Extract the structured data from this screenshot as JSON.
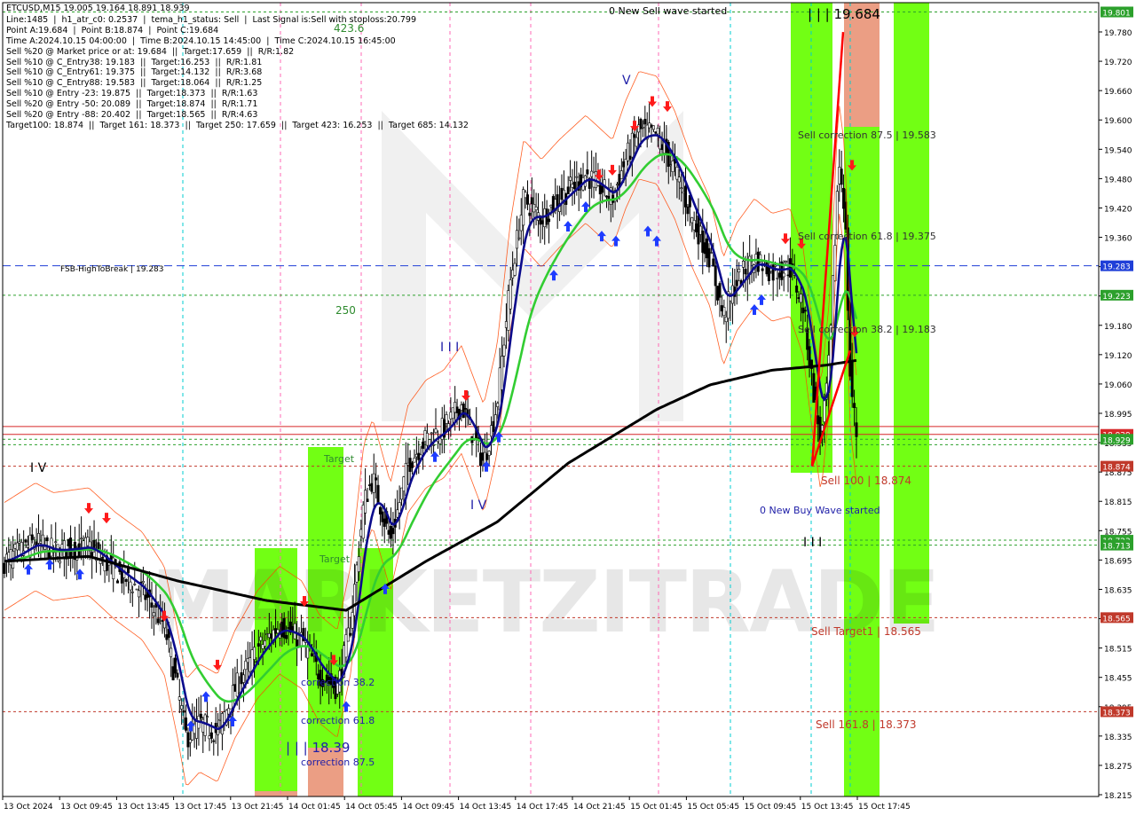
{
  "chart_data": {
    "type": "candlestick",
    "symbol_header": "ETCUSD,M15  19.005 19.164 18.891 18.939",
    "info_lines": [
      "Line:1485  |  h1_atr_c0: 0.2537  |  tema_h1_status: Sell  |  Last Signal is:Sell with stoploss:20.799",
      "Point A:19.684  |  Point B:18.874  |  Point C:19.684",
      "Time A:2024.10.15 04:00:00  |  Time B:2024.10.15 14:45:00  |  Time C:2024.10.15 16:45:00",
      "Sell %20 @ Market price or at: 19.684  ||  Target:17.659  ||  R/R:1.82",
      "Sell %10 @ C_Entry38: 19.183  ||  Target:16.253  ||  R/R:1.81",
      "Sell %10 @ C_Entry61: 19.375  ||  Target:14.132  ||  R/R:3.68",
      "Sell %10 @ C_Entry88: 19.583  ||  Target:18.064  ||  R/R:1.25",
      "Sell %10 @ Entry -23: 19.875  ||  Target:18.373  ||  R/R:1.63",
      "Sell %20 @ Entry -50: 20.089  ||  Target:18.874  ||  R/R:1.71",
      "Sell %20 @ Entry -88: 20.402  ||  Target:18.565  ||  R/R:4.63",
      "Target100: 18.874  ||  Target 161: 18.373  ||  Target 250: 17.659  ||  Target 423: 16.253  ||  Target 685: 14.132"
    ],
    "y_ticks": [
      "19.780",
      "19.720",
      "19.660",
      "19.600",
      "19.540",
      "19.480",
      "19.420",
      "19.360",
      "19.300",
      "19.240",
      "19.180",
      "19.120",
      "19.060",
      "18.995",
      "18.935",
      "18.875",
      "18.815",
      "18.755",
      "18.695",
      "18.635",
      "18.575",
      "18.515",
      "18.455",
      "18.395",
      "18.335",
      "18.275",
      "18.215"
    ],
    "x_ticks": [
      "13 Oct 2024",
      "13 Oct 09:45",
      "13 Oct 13:45",
      "13 Oct 17:45",
      "13 Oct 21:45",
      "14 Oct 01:45",
      "14 Oct 05:45",
      "14 Oct 09:45",
      "14 Oct 13:45",
      "14 Oct 17:45",
      "14 Oct 21:45",
      "15 Oct 01:45",
      "15 Oct 05:45",
      "15 Oct 09:45",
      "15 Oct 13:45",
      "15 Oct 17:45"
    ],
    "ylim": [
      18.2,
      19.82
    ],
    "price_badges": [
      {
        "label": "19.801",
        "value": 19.801,
        "color": "#2ca02c"
      },
      {
        "label": "19.283",
        "value": 19.283,
        "color": "#1f3fd8"
      },
      {
        "label": "19.223",
        "value": 19.223,
        "color": "#2ca02c"
      },
      {
        "label": "18.939",
        "value": 18.939,
        "color": "#d62728"
      },
      {
        "label": "18.929",
        "value": 18.929,
        "color": "#2ca02c"
      },
      {
        "label": "18.874",
        "value": 18.874,
        "color": "#c0392b"
      },
      {
        "label": "18.723",
        "value": 18.723,
        "color": "#2ca02c"
      },
      {
        "label": "18.713",
        "value": 18.713,
        "color": "#2ca02c"
      },
      {
        "label": "18.565",
        "value": 18.565,
        "color": "#c0392b"
      },
      {
        "label": "18.373",
        "value": 18.373,
        "color": "#c0392b"
      }
    ],
    "h_lines": [
      {
        "value": 19.801,
        "color": "#2ca02c",
        "style": "dot"
      },
      {
        "value": 19.283,
        "color": "#1f3fd8",
        "style": "dash"
      },
      {
        "value": 19.223,
        "color": "#2ca02c",
        "style": "dot"
      },
      {
        "value": 18.955,
        "color": "#d62728",
        "style": "solid"
      },
      {
        "value": 18.939,
        "color": "#d62728",
        "style": "solid"
      },
      {
        "value": 18.929,
        "color": "#2ca02c",
        "style": "dot"
      },
      {
        "value": 18.918,
        "color": "#2ca02c",
        "style": "dot"
      },
      {
        "value": 18.874,
        "color": "#c0392b",
        "style": "dot"
      },
      {
        "value": 18.723,
        "color": "#2ca02c",
        "style": "dot"
      },
      {
        "value": 18.713,
        "color": "#2ca02c",
        "style": "dot"
      },
      {
        "value": 18.565,
        "color": "#c0392b",
        "style": "dot"
      },
      {
        "value": 18.373,
        "color": "#c0392b",
        "style": "dot"
      }
    ],
    "annotations": {
      "new_sell_wave": "0 New Sell wave started",
      "new_buy_wave": "0 New Buy Wave started",
      "fsb_label": "FSB-HighToBreak | 19.283",
      "level_423": "423.6",
      "level_250": "250",
      "wave_peak": "| | | 19.684",
      "sell_corr_875": "Sell correction 87.5 | 19.583",
      "sell_corr_618": "Sell correction 61.8 | 19.375",
      "sell_corr_382": "Sell correction 38.2 | 19.183",
      "sell_100": "Sell 100 | 18.874",
      "sell_target1": "Sell Target1 | 18.565",
      "sell_1618": "Sell 161.8 | 18.373",
      "wave_iii_low": "| | | 18.39",
      "corr_382": "correction 38.2",
      "corr_618": "correction 61.8",
      "corr_875": "correction 87.5",
      "target_lbl1": "Target",
      "target_lbl2": "Target",
      "wave_iv": "I V",
      "wave_v": "V",
      "wave_iii_mid": "I I I",
      "wave_iv_mid": "I V",
      "wave_iii_right": "I I I",
      "watermark": "MARKETZITRADE"
    },
    "colors": {
      "bg": "#ffffff",
      "candle": "#000000",
      "blue_ma": "#0b0b8c",
      "green_ma": "#32cd32",
      "black_ma": "#000000",
      "env": "#ff4500",
      "bright_green": "#66ff00",
      "salmon": "#e9967a",
      "cyan_vline": "#00ced1",
      "pink_vline": "#ff69b4",
      "buy_arrow": "#1e3cff",
      "sell_arrow": "#ff1a1a"
    }
  }
}
